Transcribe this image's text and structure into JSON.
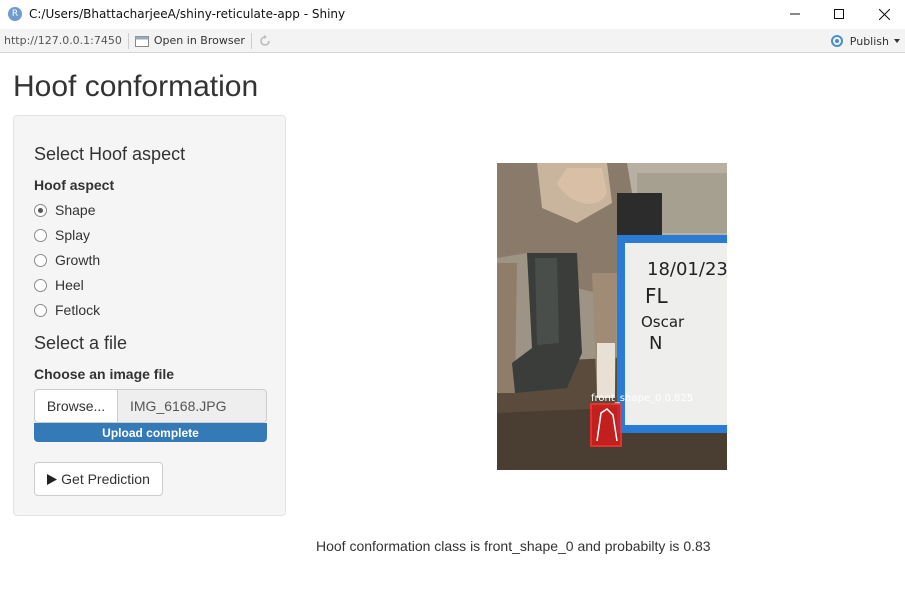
{
  "window": {
    "title": "C:/Users/BhattacharjeeA/shiny-reticulate-app - Shiny",
    "app_icon_letter": "R"
  },
  "toolbar": {
    "url": "http://127.0.0.1:7450",
    "open_in_browser": "Open in Browser",
    "publish": "Publish"
  },
  "page": {
    "title": "Hoof conformation"
  },
  "sidebar": {
    "aspect_heading": "Select Hoof aspect",
    "aspect_label": "Hoof aspect",
    "options": [
      "Shape",
      "Splay",
      "Growth",
      "Heel",
      "Fetlock"
    ],
    "selected": "Shape",
    "file_heading": "Select a file",
    "file_label": "Choose an image file",
    "browse_label": "Browse...",
    "file_name": "IMG_6168.JPG",
    "upload_status": "Upload complete",
    "upload_progress_percent": 100,
    "predict_button": "Get Prediction"
  },
  "result": {
    "detection_label": "front_shape_0 0.825",
    "board_text": [
      "18/01/23",
      "FL",
      "Oscar",
      "N"
    ],
    "message": "Hoof conformation class is front_shape_0 and probabilty is 0.83"
  },
  "icons": {
    "app": "r-logo-icon",
    "open_browser": "open-browser-icon",
    "refresh": "refresh-icon",
    "publish": "publish-icon",
    "predict": "play-icon"
  },
  "colors": {
    "progress_bar": "#337ab7",
    "panel_bg": "#f5f5f5",
    "detection_box": "#e02020"
  }
}
